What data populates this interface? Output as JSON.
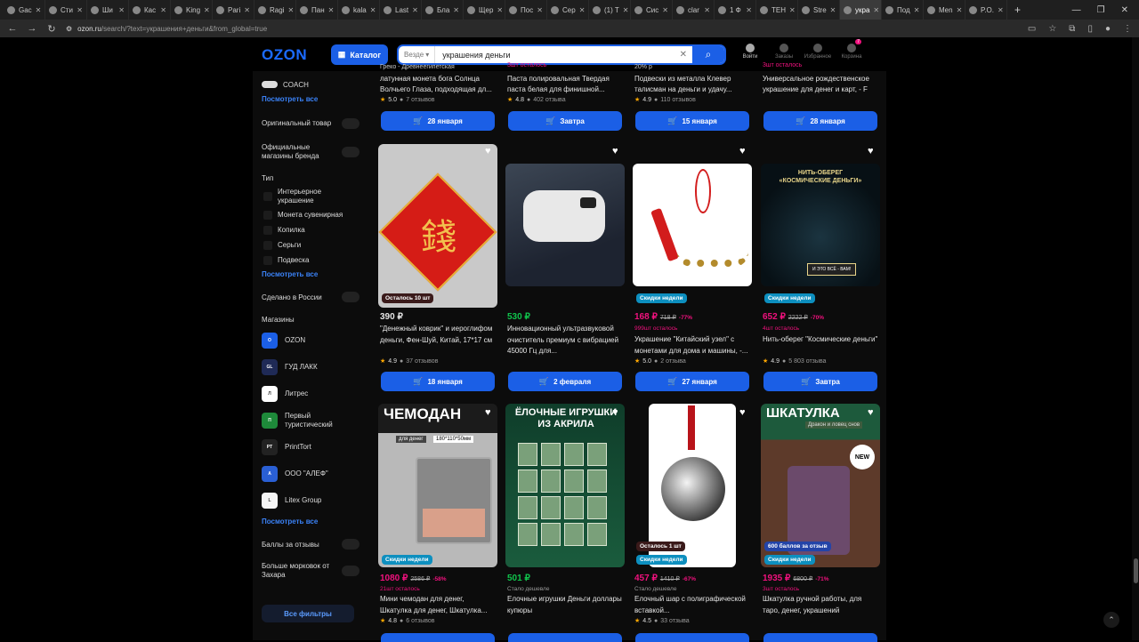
{
  "browser": {
    "tabs": [
      "Gac",
      "Сти",
      "Ши",
      "Кас",
      "King",
      "Pari",
      "Ragi",
      "Пан",
      "kala",
      "Last",
      "Бла",
      "Щер",
      "Пос",
      "Сер",
      "(1) T",
      "Сис",
      "clar",
      "1 Ф",
      "TEH",
      "Stre",
      "укра",
      "Под",
      "Men",
      "P.O."
    ],
    "active_tab_index": 20,
    "url_host": "ozon.ru",
    "url_path": "/search/?text=украшения+деньги&from_global=true"
  },
  "header": {
    "logo": "OZON",
    "catalog_label": "Каталог",
    "search_scope": "Везде",
    "search_value": "украшения деньги",
    "icons": [
      {
        "label": "Войти",
        "icon": "user-icon"
      },
      {
        "label": "Заказы",
        "icon": "box-icon"
      },
      {
        "label": "Избранное",
        "icon": "heart-icon"
      },
      {
        "label": "Корзина",
        "icon": "cart-icon",
        "badge": "7"
      }
    ]
  },
  "sidebar": {
    "brand_top": "COACH",
    "see_all_1": "Посмотреть все",
    "original": "Оригинальный товар",
    "official": "Официальные магазины бренда",
    "type_title": "Тип",
    "types": [
      "Интерьерное украшение",
      "Монета сувенирная",
      "Копилка",
      "Серьги",
      "Подвеска"
    ],
    "see_all_2": "Посмотреть все",
    "made_in_russia": "Сделано в России",
    "shops_title": "Магазины",
    "shops": [
      {
        "name": "OZON",
        "color": "#1b5fe6",
        "abbr": "O"
      },
      {
        "name": "ГУД ЛАКК",
        "color": "#1f2a56",
        "abbr": "GL"
      },
      {
        "name": "Литрес",
        "color": "#ffffff",
        "abbr": "Л"
      },
      {
        "name": "Первый туристический",
        "color": "#1e8a3a",
        "abbr": "П"
      },
      {
        "name": "PrintTort",
        "color": "#222222",
        "abbr": "PT"
      },
      {
        "name": "ООО \"АЛЕФ\"",
        "color": "#2a5fd4",
        "abbr": "A"
      },
      {
        "name": "Litex Group",
        "color": "#f5f5f5",
        "abbr": "L"
      }
    ],
    "see_all_3": "Посмотреть все",
    "points_for_reviews": "Баллы за отзывы",
    "more_carrots": "Больше морковок от Захара",
    "all_filters": "Все фильтры"
  },
  "row0": [
    {
      "title1": "Греко - Древнеегипетская",
      "title2": "латунная монета бога Солнца",
      "title3": "Волчьего Глаза, подходящая дл...",
      "rating": "5.0",
      "reviews": "7 отзывов",
      "button": "28 января"
    },
    {
      "title1": "3шт осталось",
      "title2": "Паста полировальная Твердая",
      "title3": "паста белая для финишной...",
      "rating": "4.8",
      "reviews": "402 отзыва",
      "button": "Завтра"
    },
    {
      "title1": "20% р",
      "title2": "Подвески из металла Клевер",
      "title3": "талисман на деньги и удачу...",
      "rating": "4.9",
      "reviews": "110 отзывов",
      "button": "15 января"
    },
    {
      "title1": "3шт осталось",
      "title2": "Универсальное рождественское",
      "title3": "украшение для денег и карт, - F",
      "rating": "",
      "reviews": "",
      "button": "28 января"
    }
  ],
  "row1": [
    {
      "chip": "Осталось 10 шт",
      "price": "390 ₽",
      "old": "",
      "disc": "",
      "note": "",
      "title": "\"Денежный коврик\" и иероглифом деньги, Фен-Шуй, Китай, 17*17 см",
      "rating": "4.9",
      "reviews": "37 отзывов",
      "button": "18 января"
    },
    {
      "chip": "",
      "price": "530 ₽",
      "old": "",
      "disc": "",
      "note": "",
      "title": "Инновационный ультразвуковой очиститель премиум с вибрацией 45000 Гц для...",
      "rating": "",
      "reviews": "",
      "button": "2 февраля"
    },
    {
      "chip": "Скидки недели",
      "price": "168 ₽",
      "old": "718 ₽",
      "disc": "-77%",
      "note": "999шт осталось",
      "title": "Украшение \"Китайский узел\" с монетами для дома и машины, -...",
      "rating": "5.0",
      "reviews": "2 отзыва",
      "button": "27 января"
    },
    {
      "chip": "Скидки недели",
      "price": "652 ₽",
      "old": "2222 ₽",
      "disc": "-70%",
      "note": "4шт осталось",
      "title": "Нить-оберег \"Космические деньги\"",
      "rating": "4.9",
      "reviews": "5 803 отзыва",
      "button": "Завтра"
    }
  ],
  "row2": [
    {
      "chip": "Скидки недели",
      "price": "1080 ₽",
      "old": "2586 ₽",
      "disc": "-58%",
      "note": "21шт осталось",
      "title": "Мини чемодан для денег, Шкатулка для денег, Шкатулка...",
      "rating": "4.8",
      "reviews": "6 отзывов"
    },
    {
      "chip": "",
      "price": "501 ₽",
      "old": "",
      "disc": "",
      "note": "Стало дешевле",
      "title": "Елочные игрушки Деньги доллары купюры",
      "rating": "",
      "reviews": ""
    },
    {
      "chip": "Скидки недели",
      "chip2": "Осталось 1 шт",
      "price": "457 ₽",
      "old": "1410 ₽",
      "disc": "-67%",
      "note": "Стало дешевле",
      "title": "Елочный шар с полиграфической вставкой...",
      "rating": "4.5",
      "reviews": "33 отзыва"
    },
    {
      "chip": "Скидки недели",
      "chip2": "600 баллов за отзыв",
      "price": "1935 ₽",
      "old": "6800 ₽",
      "disc": "-71%",
      "note": "3шт осталось",
      "title": "Шкатулка ручной работы, для таро, денег, украшений",
      "rating": "",
      "reviews": ""
    }
  ],
  "image_text": {
    "p2_img1": "ЧЕМОДАН",
    "p2_img1_sub": "для денег",
    "p2_img1_dims": "180*110*50мм",
    "p2_img2": "ЁЛОЧНЫЕ ИГРУШКИ ИЗ АКРИЛА",
    "p2_img4": "ШКАТУЛКА",
    "p2_img4_sub": "Дракон и ловец снов",
    "p2_img4_badge": "NEW",
    "p1_img4_top": "НИТЬ-ОБЕРЕГ «КОСМИЧЕСКИЕ ДЕНЬГИ»",
    "p1_img4_bottom": "И ЭТО ВСЁ - ВАМ!"
  }
}
